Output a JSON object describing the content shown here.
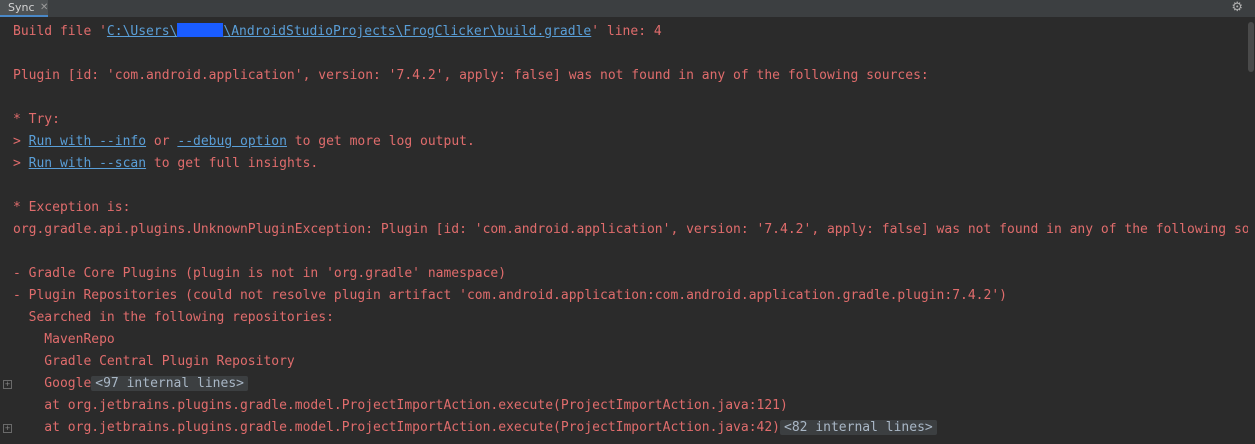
{
  "tab": {
    "label": "Sync",
    "close_glyph": "✕"
  },
  "gear_glyph": "⚙",
  "lines": {
    "l1": {
      "pre": "Build file '",
      "link": "C:\\Users\\",
      "link2": "\\AndroidStudioProjects\\FrogClicker\\build.gradle",
      "post": "' line: 4"
    },
    "l2": "Plugin [id: 'com.android.application', version: '7.4.2', apply: false] was not found in any of the following sources:",
    "l3": "* Try:",
    "l4": {
      "pre": "> ",
      "link1": "Run with --info",
      "mid": " or ",
      "link2": "--debug option",
      "post": " to get more log output."
    },
    "l5": {
      "pre": "> ",
      "link": "Run with --scan",
      "post": " to get full insights."
    },
    "l6": "* Exception is:",
    "l7": "org.gradle.api.plugins.UnknownPluginException: Plugin [id: 'com.android.application', version: '7.4.2', apply: false] was not found in any of the following sources:",
    "l8": "- Gradle Core Plugins (plugin is not in 'org.gradle' namespace)",
    "l9": "- Plugin Repositories (could not resolve plugin artifact 'com.android.application:com.android.application.gradle.plugin:7.4.2')",
    "l10": "  Searched in the following repositories:",
    "l11": "    MavenRepo",
    "l12": "    Gradle Central Plugin Repository",
    "l13": {
      "text": "    Google",
      "badge": "<97 internal lines>"
    },
    "l14": "    at org.jetbrains.plugins.gradle.model.ProjectImportAction.execute(ProjectImportAction.java:121)",
    "l15": {
      "text": "    at org.jetbrains.plugins.gradle.model.ProjectImportAction.execute(ProjectImportAction.java:42)",
      "badge": "<82 internal lines>"
    }
  },
  "colors": {
    "error_text": "#e06c6c",
    "link": "#5a9fd8",
    "background": "#2b2b2b"
  }
}
